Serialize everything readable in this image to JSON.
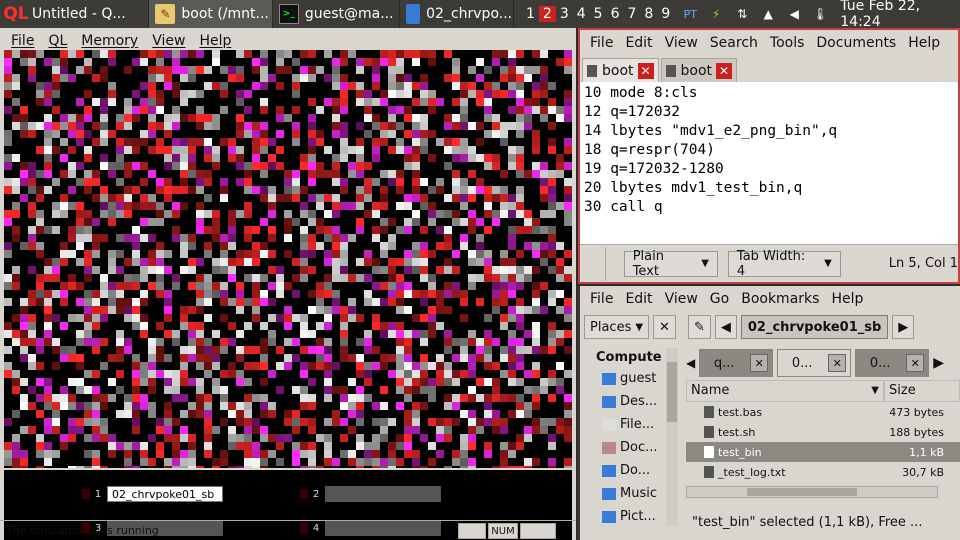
{
  "taskbar": {
    "tasks": [
      {
        "label": "Untitled - Q...",
        "icon": "ql-logo-icon",
        "active": false
      },
      {
        "label": "boot (/mnt...",
        "icon": "text-editor-icon",
        "active": true
      },
      {
        "label": "guest@ma...",
        "icon": "terminal-icon",
        "active": false
      },
      {
        "label": "02_chrvpo...",
        "icon": "folder-icon",
        "active": false
      }
    ],
    "workspaces": [
      "1",
      "2",
      "3",
      "4",
      "5",
      "6",
      "7",
      "8",
      "9"
    ],
    "current_workspace": "2",
    "clock": "Tue Feb 22, 14:24",
    "tray_text": "PT"
  },
  "ql": {
    "menu": [
      "File",
      "QL",
      "Memory",
      "View",
      "Help"
    ],
    "drives": [
      {
        "num": "1",
        "label": "02_chrvpoke01_sb"
      },
      {
        "num": "2",
        "label": ""
      },
      {
        "num": "3",
        "label": ""
      },
      {
        "num": "4",
        "label": ""
      }
    ],
    "status": "The emulated QL is running",
    "num_indicator": "NUM"
  },
  "editor": {
    "menu": [
      "File",
      "Edit",
      "View",
      "Search",
      "Tools",
      "Documents",
      "Help"
    ],
    "tabs": [
      "boot",
      "boot"
    ],
    "lines": [
      "10 mode 8:cls",
      "12 q=172032",
      "14 lbytes \"mdv1_e2_png_bin\",q",
      "18 q=respr(704)",
      "19 q=172032-1280",
      "20 lbytes mdv1_test_bin,q",
      "30 call q"
    ],
    "syntax": "Plain Text",
    "tab_width": "Tab Width:  4",
    "position": "Ln 5, Col 1"
  },
  "fm": {
    "menu": [
      "File",
      "Edit",
      "View",
      "Go",
      "Bookmarks",
      "Help"
    ],
    "places_label": "Places",
    "path": "02_chrvpoke01_sb",
    "sidebar_header": "Compute",
    "sidebar": [
      "guest",
      "Des...",
      "File...",
      "Doc...",
      "Do...",
      "Music",
      "Pict..."
    ],
    "tabs": [
      "q...",
      "0...",
      "0..."
    ],
    "col_name": "Name",
    "col_size": "Size",
    "files": [
      {
        "name": "test.bas",
        "size": "473 bytes"
      },
      {
        "name": "test.sh",
        "size": "188 bytes"
      },
      {
        "name": "test_bin",
        "size": "1,1 kB",
        "selected": true
      },
      {
        "name": "_test_log.txt",
        "size": "30,7 kB"
      }
    ],
    "status": "\"test_bin\" selected (1,1 kB), Free ..."
  },
  "colors": {
    "accent_red": "#cc2222",
    "ql_red": "#ff2a2a",
    "panel": "#d9d6d0"
  }
}
